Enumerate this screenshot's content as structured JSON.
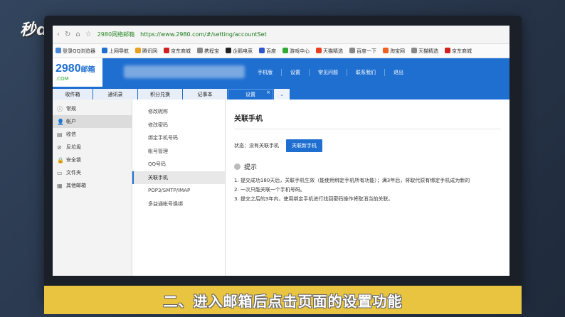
{
  "watermark": "秒dong视频",
  "browser": {
    "site_name": "2980网络邮箱",
    "url": "https://www.2980.com/#/setting/accountSet",
    "bookmarks": [
      {
        "label": "登录QQ浏览器",
        "color": "#4a8ad8"
      },
      {
        "label": "上网导航",
        "color": "#1f6fd1"
      },
      {
        "label": "腾讯网",
        "color": "#e8a020"
      },
      {
        "label": "京东商城",
        "color": "#d02020"
      },
      {
        "label": "携程宝",
        "color": "#888888"
      },
      {
        "label": "企鹅电竞",
        "color": "#222222"
      },
      {
        "label": "百度",
        "color": "#3355cc"
      },
      {
        "label": "游戏中心",
        "color": "#33aa33"
      },
      {
        "label": "天猫精选",
        "color": "#e84020"
      },
      {
        "label": "百度一下",
        "color": "#888888"
      },
      {
        "label": "淘宝网",
        "color": "#f06020"
      },
      {
        "label": "天猫精选",
        "color": "#888888"
      },
      {
        "label": "京东商城",
        "color": "#d02020"
      }
    ]
  },
  "mail": {
    "logo_number": "2980",
    "logo_suffix": "邮箱",
    "logo_domain": ".COM",
    "top_nav": [
      "手机版",
      "设置",
      "常见问题",
      "联系我们",
      "退出"
    ],
    "tabs": [
      "收件箱",
      "通讯录",
      "积分兑换",
      "记事本"
    ],
    "active_tab": "设置",
    "close_glyph": "×",
    "dropdown_glyph": "⌄",
    "left_menu": [
      {
        "label": "常规",
        "icon": "ⓘ"
      },
      {
        "label": "帐户",
        "icon": "👤"
      },
      {
        "label": "收信",
        "icon": "▤"
      },
      {
        "label": "反垃圾",
        "icon": "⊘"
      },
      {
        "label": "安全锁",
        "icon": "🔒"
      },
      {
        "label": "文件夹",
        "icon": "▭"
      },
      {
        "label": "其他邮箱",
        "icon": "▦"
      }
    ],
    "sub_menu": [
      "修改昵称",
      "修改密码",
      "绑定手机号码",
      "帐号管理",
      "QQ号码",
      "关联手机",
      "POP3/SMTP/IMAP",
      "多益通帐号换绑"
    ],
    "panel": {
      "title": "关联手机",
      "status": "状态：没有关联手机",
      "button": "关联新手机",
      "tip_title": "提示",
      "tips": [
        "1. 提交成功180天后，关联手机生效（能使用绑定手机所有功能）；满3年后，将取代原有绑定手机成为新的",
        "2. 一次只能关联一个手机号码。",
        "3. 提交之后的3年内，使用绑定手机进行找回密码操作将取消当前关联。"
      ]
    }
  },
  "caption": "二、进入邮箱后点击页面的设置功能"
}
